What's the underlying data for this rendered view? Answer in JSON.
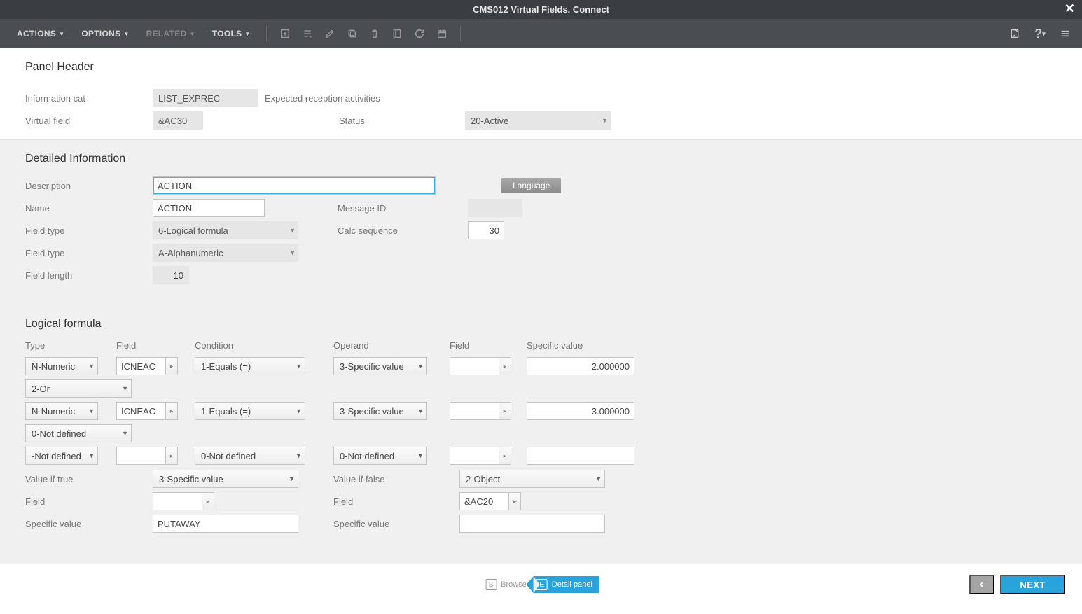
{
  "titlebar": {
    "title": "CMS012 Virtual Fields. Connect"
  },
  "menus": {
    "actions": "ACTIONS",
    "options": "OPTIONS",
    "related": "RELATED",
    "tools": "TOOLS"
  },
  "panel_header": {
    "title": "Panel Header",
    "labels": {
      "info_cat": "Information cat",
      "virtual_field": "Virtual field",
      "status": "Status"
    },
    "info_cat_value": "LIST_EXPREC",
    "info_cat_desc": "Expected reception activities",
    "virtual_field_value": "&AC30",
    "status_value": "20-Active"
  },
  "detailed": {
    "title": "Detailed Information",
    "labels": {
      "description": "Description",
      "name": "Name",
      "message_id": "Message ID",
      "field_type1": "Field type",
      "calc_seq": "Calc sequence",
      "field_type2": "Field type",
      "field_length": "Field length"
    },
    "description": "ACTION",
    "name": "ACTION",
    "message_id": "",
    "field_type1": "6-Logical formula",
    "calc_seq": "30",
    "field_type2": "A-Alphanumeric",
    "field_length": "10",
    "language_button": "Language"
  },
  "logical": {
    "title": "Logical formula",
    "headers": {
      "type": "Type",
      "field": "Field",
      "condition": "Condition",
      "operand": "Operand",
      "field2": "Field",
      "specific": "Specific value"
    },
    "rows": [
      {
        "type": "N-Numeric",
        "field": "ICNEAC",
        "condition": "1-Equals (=)",
        "operand": "3-Specific value",
        "field2": "",
        "specific": "2.000000"
      }
    ],
    "connector1": "2-Or",
    "rows2": [
      {
        "type": "N-Numeric",
        "field": "ICNEAC",
        "condition": "1-Equals (=)",
        "operand": "3-Specific value",
        "field2": "",
        "specific": "3.000000"
      }
    ],
    "connector2": "0-Not defined",
    "rows3": [
      {
        "type": "-Not defined",
        "field": "",
        "condition": "0-Not defined",
        "operand": "0-Not defined",
        "field2": "",
        "specific": ""
      }
    ],
    "labels": {
      "val_true": "Value if true",
      "val_false": "Value if false",
      "field": "Field",
      "specific": "Specific value"
    },
    "val_true": "3-Specific value",
    "val_false": "2-Object",
    "field_true": "",
    "field_false": "&AC20",
    "specific_true": "PUTAWAY",
    "specific_false": ""
  },
  "tabs": {
    "browse": {
      "letter": "B",
      "label": "Browse"
    },
    "detail": {
      "letter": "E",
      "label": "Detail panel"
    }
  },
  "footer": {
    "next": "NEXT"
  }
}
